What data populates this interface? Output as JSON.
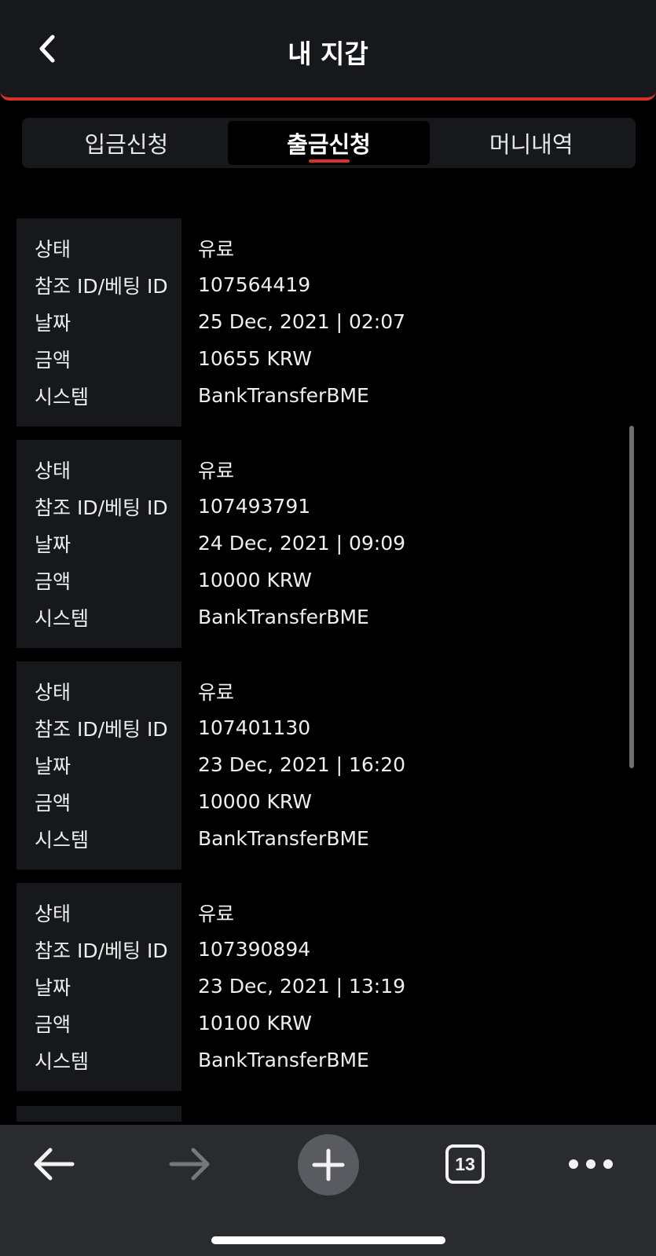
{
  "header": {
    "title": "내 지갑",
    "back_icon": "chevron-left-icon"
  },
  "tabs": [
    {
      "label": "입금신청",
      "active": false
    },
    {
      "label": "출금신청",
      "active": true
    },
    {
      "label": "머니내역",
      "active": false
    }
  ],
  "records": [
    {
      "status_label": "상태",
      "status": "유료",
      "ref_label": "참조 ID/베팅 ID",
      "ref": "107564419",
      "date_label": "날짜",
      "date": "25 Dec, 2021 | 02:07",
      "amount_label": "금액",
      "amount": "10655 KRW",
      "system_label": "시스템",
      "system": "BankTransferBME"
    },
    {
      "status_label": "상태",
      "status": "유료",
      "ref_label": "참조 ID/베팅 ID",
      "ref": "107493791",
      "date_label": "날짜",
      "date": "24 Dec, 2021 | 09:09",
      "amount_label": "금액",
      "amount": "10000 KRW",
      "system_label": "시스템",
      "system": "BankTransferBME"
    },
    {
      "status_label": "상태",
      "status": "유료",
      "ref_label": "참조 ID/베팅 ID",
      "ref": "107401130",
      "date_label": "날짜",
      "date": "23 Dec, 2021 | 16:20",
      "amount_label": "금액",
      "amount": "10000 KRW",
      "system_label": "시스템",
      "system": "BankTransferBME"
    },
    {
      "status_label": "상태",
      "status": "유료",
      "ref_label": "참조 ID/베팅 ID",
      "ref": "107390894",
      "date_label": "날짜",
      "date": "23 Dec, 2021 | 13:19",
      "amount_label": "금액",
      "amount": "10100 KRW",
      "system_label": "시스템",
      "system": "BankTransferBME"
    }
  ],
  "toolbar": {
    "back_icon": "arrow-left-icon",
    "forward_icon": "arrow-right-icon",
    "new_tab_icon": "plus-icon",
    "tab_count": "13",
    "more_icon": "more-dots-icon"
  },
  "colors": {
    "accent": "#d9312a",
    "panel": "#17181c",
    "background": "#000000",
    "toolbar": "#2a2b2f"
  }
}
